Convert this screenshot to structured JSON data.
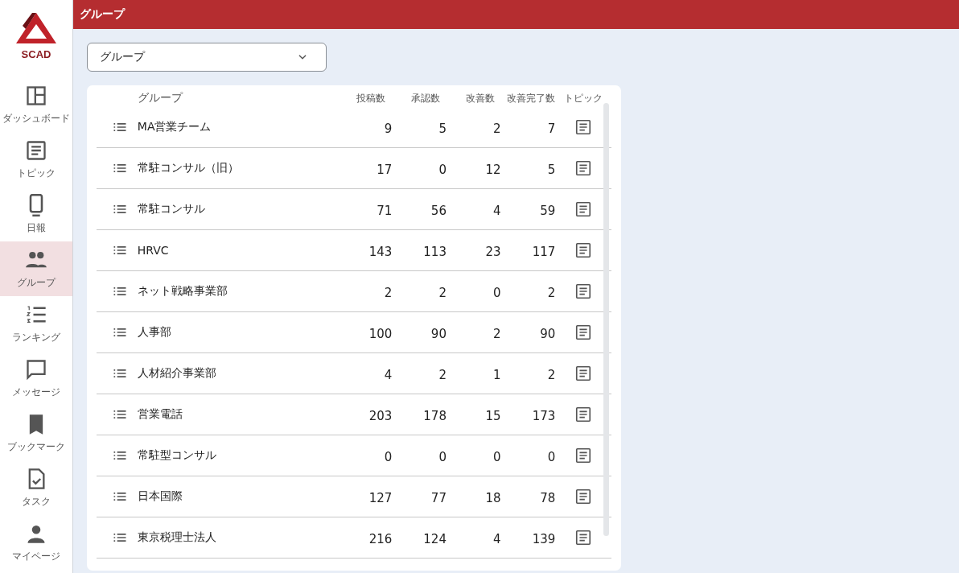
{
  "logo": {
    "text": "SCAD"
  },
  "header": {
    "title": "グループ"
  },
  "sidebar": {
    "items": [
      {
        "label": "ダッシュボード",
        "selected": false
      },
      {
        "label": "トピック",
        "selected": false
      },
      {
        "label": "日報",
        "selected": false
      },
      {
        "label": "グループ",
        "selected": true
      },
      {
        "label": "ランキング",
        "selected": false
      },
      {
        "label": "メッセージ",
        "selected": false
      },
      {
        "label": "ブックマーク",
        "selected": false
      },
      {
        "label": "タスク",
        "selected": false
      },
      {
        "label": "マイページ",
        "selected": false
      }
    ]
  },
  "filter": {
    "value": "グループ"
  },
  "table": {
    "columns": [
      "グループ",
      "投稿数",
      "承認数",
      "改善数",
      "改善完了数",
      "トピック"
    ],
    "rows": [
      {
        "name": "MA営業チーム",
        "posts": "9",
        "approved": "5",
        "improvements": "2",
        "completed": "7"
      },
      {
        "name": "常駐コンサル（旧）",
        "posts": "17",
        "approved": "0",
        "improvements": "12",
        "completed": "5"
      },
      {
        "name": "常駐コンサル",
        "posts": "71",
        "approved": "56",
        "improvements": "4",
        "completed": "59"
      },
      {
        "name": "HRVC",
        "posts": "143",
        "approved": "113",
        "improvements": "23",
        "completed": "117"
      },
      {
        "name": "ネット戦略事業部",
        "posts": "2",
        "approved": "2",
        "improvements": "0",
        "completed": "2"
      },
      {
        "name": "人事部",
        "posts": "100",
        "approved": "90",
        "improvements": "2",
        "completed": "90"
      },
      {
        "name": "人材紹介事業部",
        "posts": "4",
        "approved": "2",
        "improvements": "1",
        "completed": "2"
      },
      {
        "name": "営業電話",
        "posts": "203",
        "approved": "178",
        "improvements": "15",
        "completed": "173"
      },
      {
        "name": "常駐型コンサル",
        "posts": "0",
        "approved": "0",
        "improvements": "0",
        "completed": "0"
      },
      {
        "name": "日本国際",
        "posts": "127",
        "approved": "77",
        "improvements": "18",
        "completed": "78"
      },
      {
        "name": "東京税理士法人",
        "posts": "216",
        "approved": "124",
        "improvements": "4",
        "completed": "139"
      }
    ]
  }
}
